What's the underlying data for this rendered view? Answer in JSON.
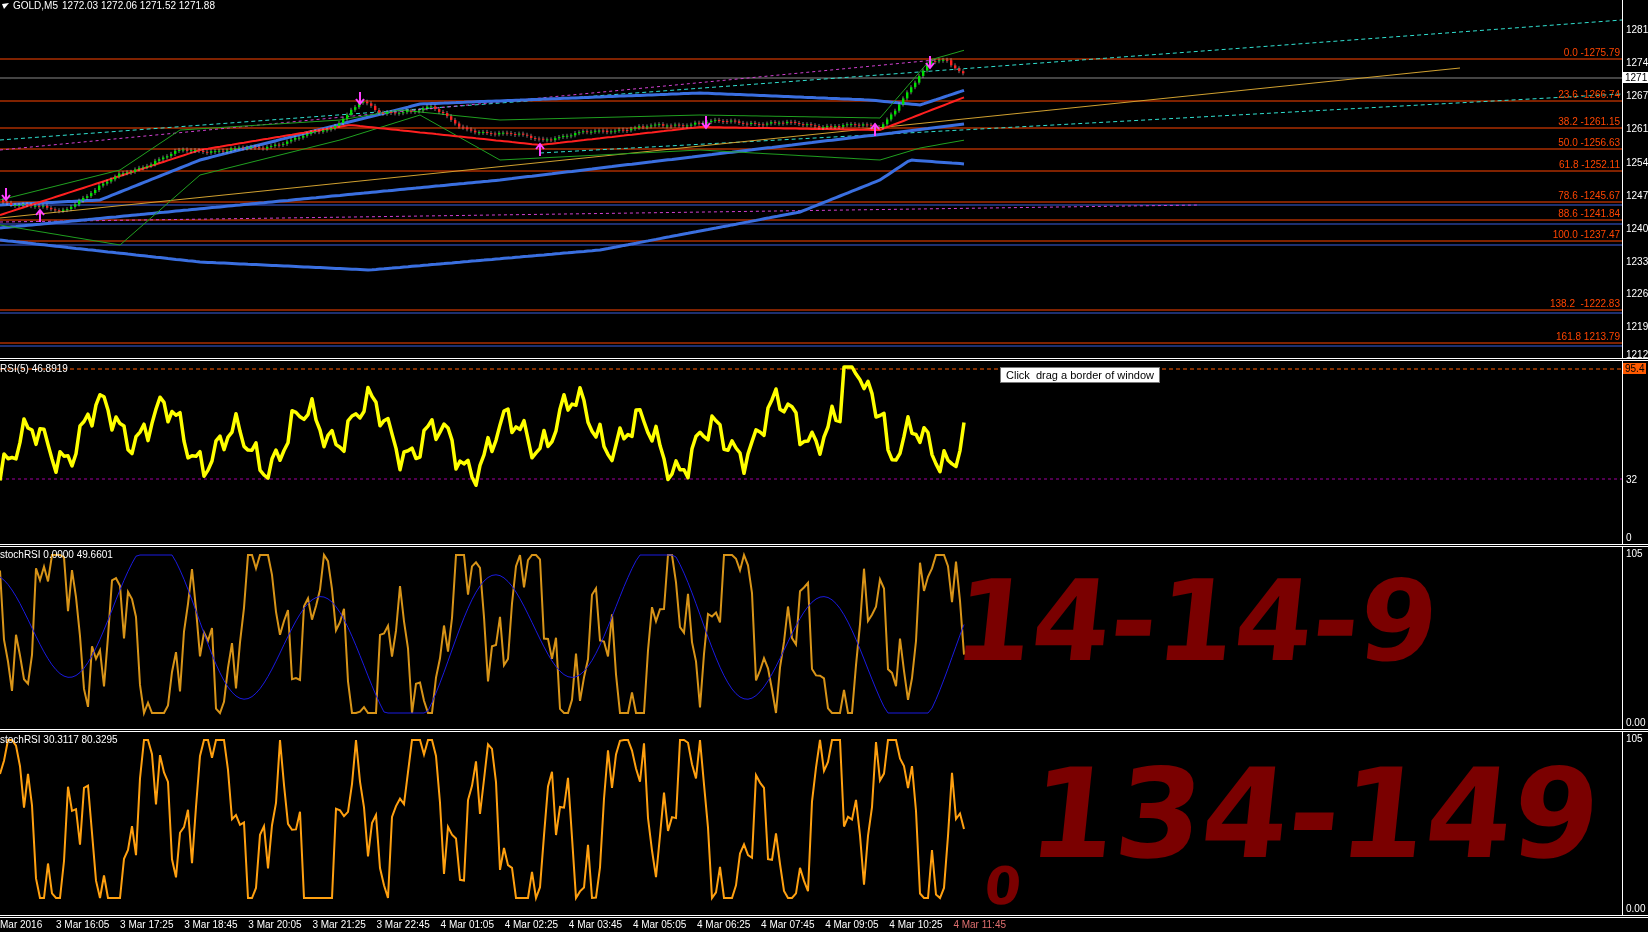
{
  "chart": {
    "symbol": "GOLD,M5",
    "quotes": "1272.03 1272.06 1271.52 1271.88",
    "price_axis": [
      "1281",
      "1274",
      "1267",
      "1261",
      "1254",
      "1247",
      "1240",
      "1233",
      "1226",
      "1219",
      "1212"
    ],
    "current_price": "1271",
    "fib_levels": [
      {
        "label": "0.0 -1275.79"
      },
      {
        "label": "23.6 -1266.74"
      },
      {
        "label": "38.2 -1261.15"
      },
      {
        "label": "50.0 -1256.63"
      },
      {
        "label": "61.8 -1252.11"
      },
      {
        "label": "78.6 -1245.67"
      },
      {
        "label": "88.6 -1241.84"
      },
      {
        "label": "100.0 -1237.47"
      },
      {
        "label": "138.2  -1222.83"
      },
      {
        "label": "161.8 1213.79"
      }
    ]
  },
  "panes": [
    {
      "kind": "rsi",
      "label": "RSI(5) 46.8919",
      "current_value": "95.4",
      "axis": [
        "32",
        "0"
      ]
    },
    {
      "kind": "stoch",
      "label": "stochRSI 0.0000 49.6601",
      "axis": [
        "105",
        "0.00"
      ]
    },
    {
      "kind": "stoch_single",
      "label": "stochRSI 30.3117 80.3295",
      "axis": [
        "105",
        "0.00"
      ]
    }
  ],
  "tooltip": "Click  drag a border of window",
  "time_axis": [
    "Mar 2016",
    "3 Mar 16:05",
    "3 Mar 17:25",
    "3 Mar 18:45",
    "3 Mar 20:05",
    "3 Mar 21:25",
    "3 Mar 22:45",
    "4 Mar 01:05",
    "4 Mar 02:25",
    "4 Mar 03:45",
    "4 Mar 05:05",
    "4 Mar 06:25",
    "4 Mar 07:45",
    "4 Mar 09:05",
    "4 Mar 10:25",
    "4 Mar 11:45"
  ],
  "annotations": [
    {
      "text": "14-14-9"
    },
    {
      "text": "134-149"
    },
    {
      "text": "0"
    }
  ]
}
